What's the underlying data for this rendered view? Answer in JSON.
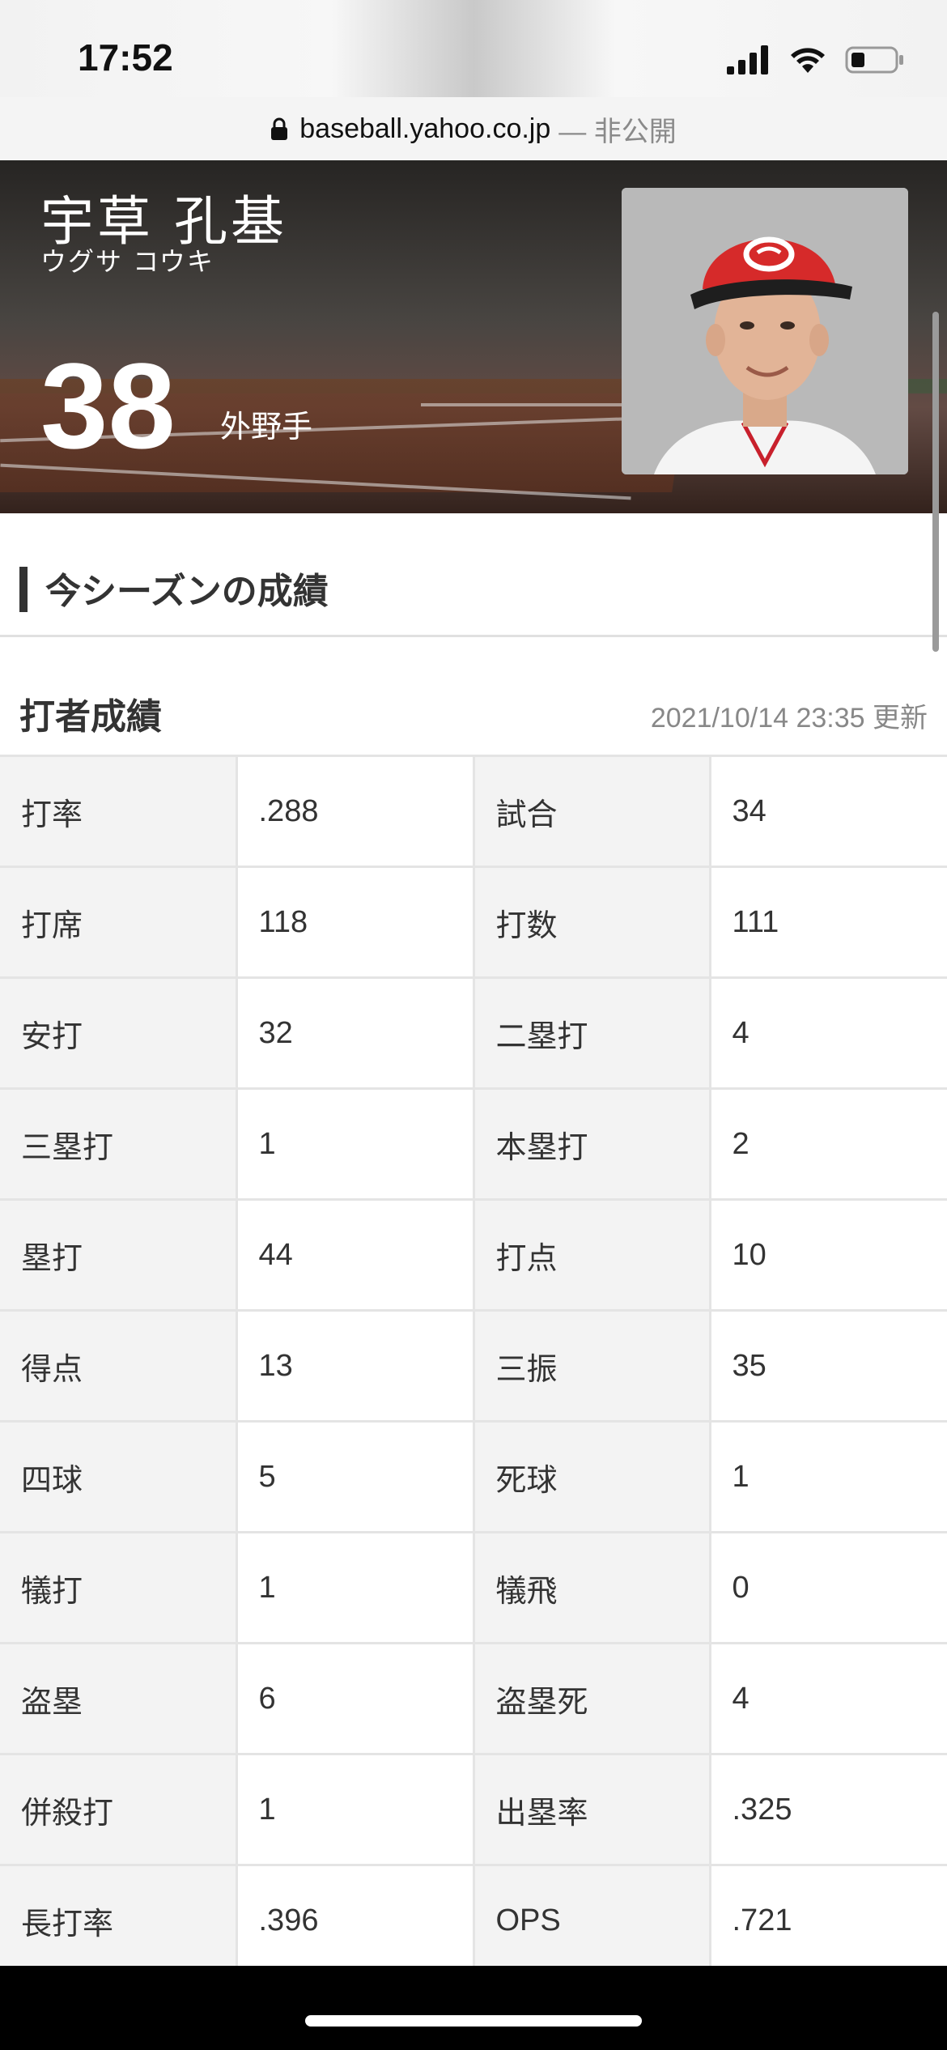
{
  "status_bar": {
    "time": "17:52"
  },
  "url_bar": {
    "domain": "baseball.yahoo.co.jp",
    "privacy": "— 非公開"
  },
  "player": {
    "name": "宇草 孔基",
    "kana": "ウグサ コウキ",
    "number": "38",
    "position": "外野手"
  },
  "section": {
    "title": "今シーズンの成績"
  },
  "batting": {
    "title": "打者成績",
    "updated": "2021/10/14 23:35 更新",
    "rows": [
      {
        "label1": "打率",
        "value1": ".288",
        "label2": "試合",
        "value2": "34"
      },
      {
        "label1": "打席",
        "value1": "118",
        "label2": "打数",
        "value2": "111"
      },
      {
        "label1": "安打",
        "value1": "32",
        "label2": "二塁打",
        "value2": "4"
      },
      {
        "label1": "三塁打",
        "value1": "1",
        "label2": "本塁打",
        "value2": "2"
      },
      {
        "label1": "塁打",
        "value1": "44",
        "label2": "打点",
        "value2": "10"
      },
      {
        "label1": "得点",
        "value1": "13",
        "label2": "三振",
        "value2": "35"
      },
      {
        "label1": "四球",
        "value1": "5",
        "label2": "死球",
        "value2": "1"
      },
      {
        "label1": "犠打",
        "value1": "1",
        "label2": "犠飛",
        "value2": "0"
      },
      {
        "label1": "盗塁",
        "value1": "6",
        "label2": "盗塁死",
        "value2": "4"
      },
      {
        "label1": "併殺打",
        "value1": "1",
        "label2": "出塁率",
        "value2": ".325"
      },
      {
        "label1": "長打率",
        "value1": ".396",
        "label2": "OPS",
        "value2": ".721"
      }
    ]
  }
}
